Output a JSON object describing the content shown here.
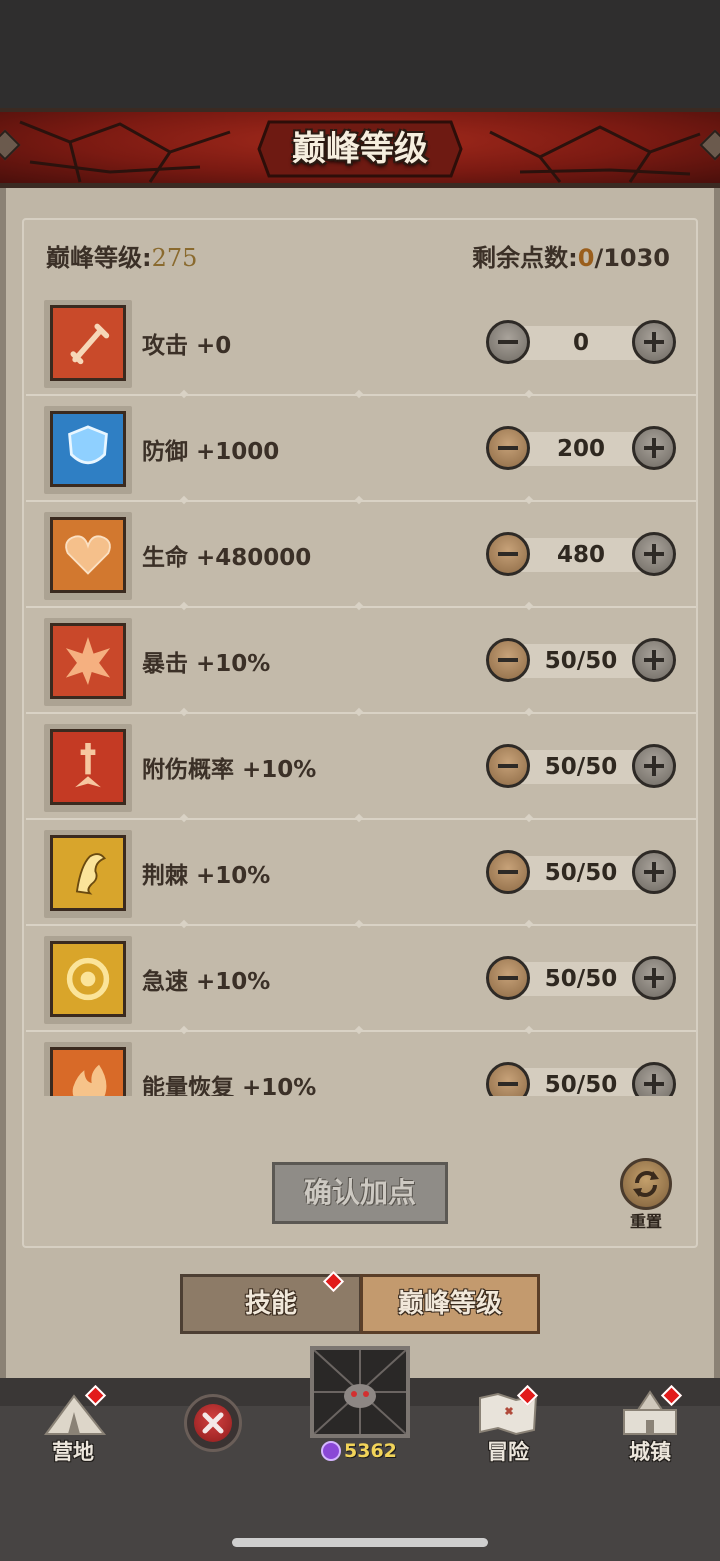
{
  "title": "巅峰等级",
  "header": {
    "level_label": "巅峰等级:",
    "level_value": "275",
    "points_label": "剩余点数:",
    "points_current": "0",
    "points_total": "/1030"
  },
  "stats": [
    {
      "label": "攻击 +0",
      "value": "0",
      "icon": "sword-icon",
      "color": "#c94a2a",
      "minus_enabled": false
    },
    {
      "label": "防御 +1000",
      "value": "200",
      "icon": "shield-icon",
      "color": "#2f7fc4",
      "minus_enabled": true
    },
    {
      "label": "生命 +480000",
      "value": "480",
      "icon": "heart-icon",
      "color": "#d2782f",
      "minus_enabled": true
    },
    {
      "label": "暴击 +10%",
      "value": "50/50",
      "icon": "burst-icon",
      "color": "#c9482a",
      "minus_enabled": true
    },
    {
      "label": "附伤概率 +10%",
      "value": "50/50",
      "icon": "dagger-impact-icon",
      "color": "#c43a24",
      "minus_enabled": true
    },
    {
      "label": "荆棘 +10%",
      "value": "50/50",
      "icon": "thorn-icon",
      "color": "#d8a52c",
      "minus_enabled": true
    },
    {
      "label": "急速 +10%",
      "value": "50/50",
      "icon": "swirl-icon",
      "color": "#d9a52a",
      "minus_enabled": true
    },
    {
      "label": "能量恢复 +10%",
      "value": "50/50",
      "icon": "flame-icon",
      "color": "#d86a28",
      "minus_enabled": true
    }
  ],
  "actions": {
    "confirm_label": "确认加点",
    "reset_label": "重置"
  },
  "tabs": [
    {
      "label": "技能",
      "active": false,
      "has_badge": true
    },
    {
      "label": "巅峰等级",
      "active": true,
      "has_badge": false
    }
  ],
  "nav": {
    "camp_label": "营地",
    "coins": "5362",
    "adventure_label": "冒险",
    "town_label": "城镇"
  }
}
